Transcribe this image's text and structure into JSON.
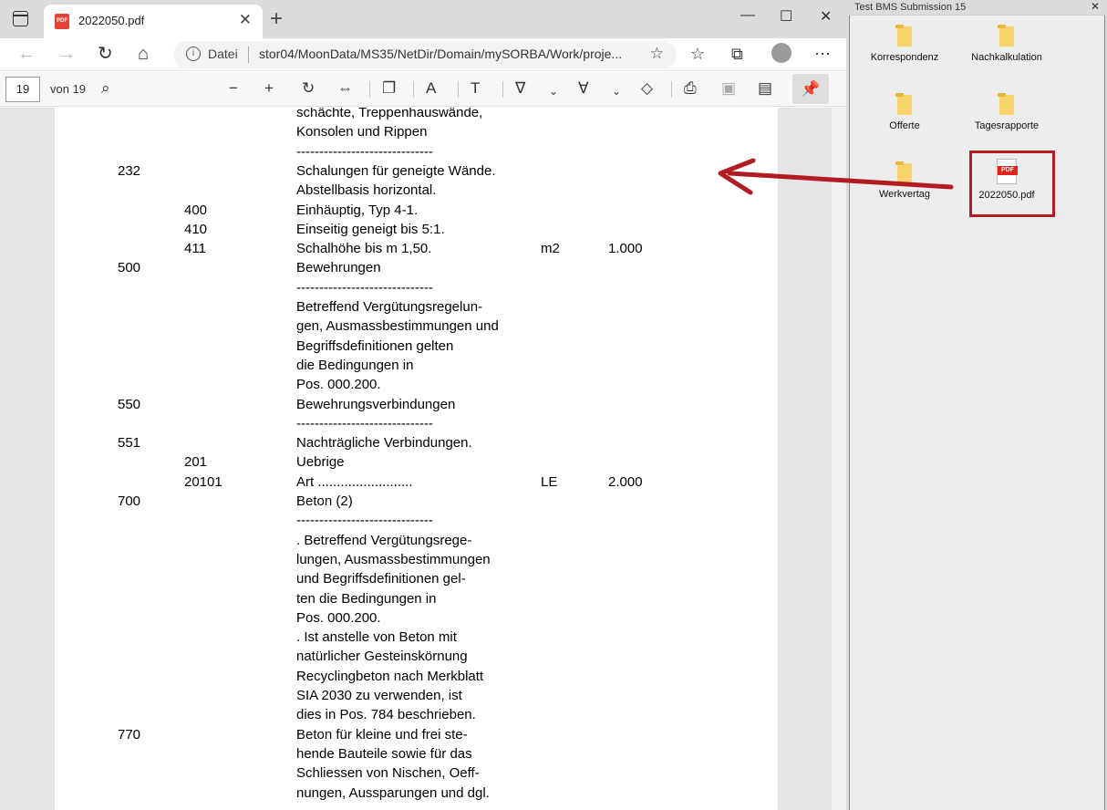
{
  "browser": {
    "tab_title": "2022050.pdf",
    "tab_icon_text": "PDF",
    "address": {
      "scheme_label": "Datei",
      "url": "stor04/MoonData/MS35/NetDir/Domain/mySORBA/Work/proje..."
    },
    "pdf_toolbar": {
      "page_number": "19",
      "page_count": "von 19"
    }
  },
  "document": {
    "rows": [
      {
        "c1": "",
        "c2": "",
        "c3": "schächte, Treppenhauswände,",
        "c4": "",
        "c5": ""
      },
      {
        "c1": "",
        "c2": "",
        "c3": "Konsolen und Rippen",
        "c4": "",
        "c5": ""
      },
      {
        "c1": "",
        "c2": "",
        "c3": "------------------------------",
        "c4": "",
        "c5": ""
      },
      {
        "c1": "232",
        "c2": "",
        "c3": "Schalungen für geneigte Wände.",
        "c4": "",
        "c5": ""
      },
      {
        "c1": "",
        "c2": "",
        "c3": "Abstellbasis horizontal.",
        "c4": "",
        "c5": ""
      },
      {
        "c1": "",
        "c2": "400",
        "c3": "Einhäuptig, Typ 4-1.",
        "c4": "",
        "c5": ""
      },
      {
        "c1": "",
        "c2": "410",
        "c3": "Einseitig geneigt bis 5:1.",
        "c4": "",
        "c5": ""
      },
      {
        "c1": "",
        "c2": "411",
        "c3": "Schalhöhe bis m 1,50.",
        "c4": "m2",
        "c5": "1.000"
      },
      {
        "c1": "500",
        "c2": "",
        "c3": "Bewehrungen",
        "c4": "",
        "c5": ""
      },
      {
        "c1": "",
        "c2": "",
        "c3": "------------------------------",
        "c4": "",
        "c5": ""
      },
      {
        "c1": "",
        "c2": "",
        "c3": "Betreffend Vergütungsregelun-",
        "c4": "",
        "c5": ""
      },
      {
        "c1": "",
        "c2": "",
        "c3": "gen, Ausmassbestimmungen und",
        "c4": "",
        "c5": ""
      },
      {
        "c1": "",
        "c2": "",
        "c3": "Begriffsdefinitionen gelten",
        "c4": "",
        "c5": ""
      },
      {
        "c1": "",
        "c2": "",
        "c3": "die Bedingungen in",
        "c4": "",
        "c5": ""
      },
      {
        "c1": "",
        "c2": "",
        "c3": "Pos. 000.200.",
        "c4": "",
        "c5": ""
      },
      {
        "c1": "550",
        "c2": "",
        "c3": "Bewehrungsverbindungen",
        "c4": "",
        "c5": ""
      },
      {
        "c1": "",
        "c2": "",
        "c3": "------------------------------",
        "c4": "",
        "c5": ""
      },
      {
        "c1": "551",
        "c2": "",
        "c3": "Nachträgliche Verbindungen.",
        "c4": "",
        "c5": ""
      },
      {
        "c1": "",
        "c2": "201",
        "c3": "Uebrige",
        "c4": "",
        "c5": ""
      },
      {
        "c1": "",
        "c2": "20101",
        "c3": "Art .........................",
        "c4": "LE",
        "c5": "2.000"
      },
      {
        "c1": "700",
        "c2": "",
        "c3": "Beton (2)",
        "c4": "",
        "c5": ""
      },
      {
        "c1": "",
        "c2": "",
        "c3": "------------------------------",
        "c4": "",
        "c5": ""
      },
      {
        "c1": "",
        "c2": "",
        "c3": ". Betreffend Vergütungsrege-",
        "c4": "",
        "c5": ""
      },
      {
        "c1": "",
        "c2": "",
        "c3": "lungen, Ausmassbestimmungen",
        "c4": "",
        "c5": ""
      },
      {
        "c1": "",
        "c2": "",
        "c3": "und Begriffsdefinitionen gel-",
        "c4": "",
        "c5": ""
      },
      {
        "c1": "",
        "c2": "",
        "c3": "ten die Bedingungen in",
        "c4": "",
        "c5": ""
      },
      {
        "c1": "",
        "c2": "",
        "c3": "Pos. 000.200.",
        "c4": "",
        "c5": ""
      },
      {
        "c1": "",
        "c2": "",
        "c3": ". Ist anstelle von Beton mit",
        "c4": "",
        "c5": ""
      },
      {
        "c1": "",
        "c2": "",
        "c3": "natürlicher Gesteinskörnung",
        "c4": "",
        "c5": ""
      },
      {
        "c1": "",
        "c2": "",
        "c3": "Recyclingbeton nach Merkblatt",
        "c4": "",
        "c5": ""
      },
      {
        "c1": "",
        "c2": "",
        "c3": "SIA 2030 zu verwenden, ist",
        "c4": "",
        "c5": ""
      },
      {
        "c1": "",
        "c2": "",
        "c3": "dies in Pos. 784 beschrieben.",
        "c4": "",
        "c5": ""
      },
      {
        "c1": "770",
        "c2": "",
        "c3": "Beton für kleine und frei ste-",
        "c4": "",
        "c5": ""
      },
      {
        "c1": "",
        "c2": "",
        "c3": "hende Bauteile sowie für das",
        "c4": "",
        "c5": ""
      },
      {
        "c1": "",
        "c2": "",
        "c3": "Schliessen von Nischen, Oeff-",
        "c4": "",
        "c5": ""
      },
      {
        "c1": "",
        "c2": "",
        "c3": "nungen, Aussparungen und dgl.",
        "c4": "",
        "c5": ""
      }
    ]
  },
  "explorer": {
    "title": "Test BMS Submission 15",
    "close": "✕",
    "items": [
      {
        "label": "Korrespondenz",
        "type": "folder"
      },
      {
        "label": "Nachkalkulation",
        "type": "folder"
      },
      {
        "label": "Offerte",
        "type": "folder"
      },
      {
        "label": "Tagesrapporte",
        "type": "folder"
      },
      {
        "label": "Werkvertag",
        "type": "folder"
      },
      {
        "label": "2022050.pdf",
        "type": "pdf",
        "icon_text": "PDF"
      }
    ]
  },
  "colors": {
    "annotation_red": "#b01c22",
    "pdf_red": "#e0241b",
    "folder_yellow": "#f8d36e"
  }
}
